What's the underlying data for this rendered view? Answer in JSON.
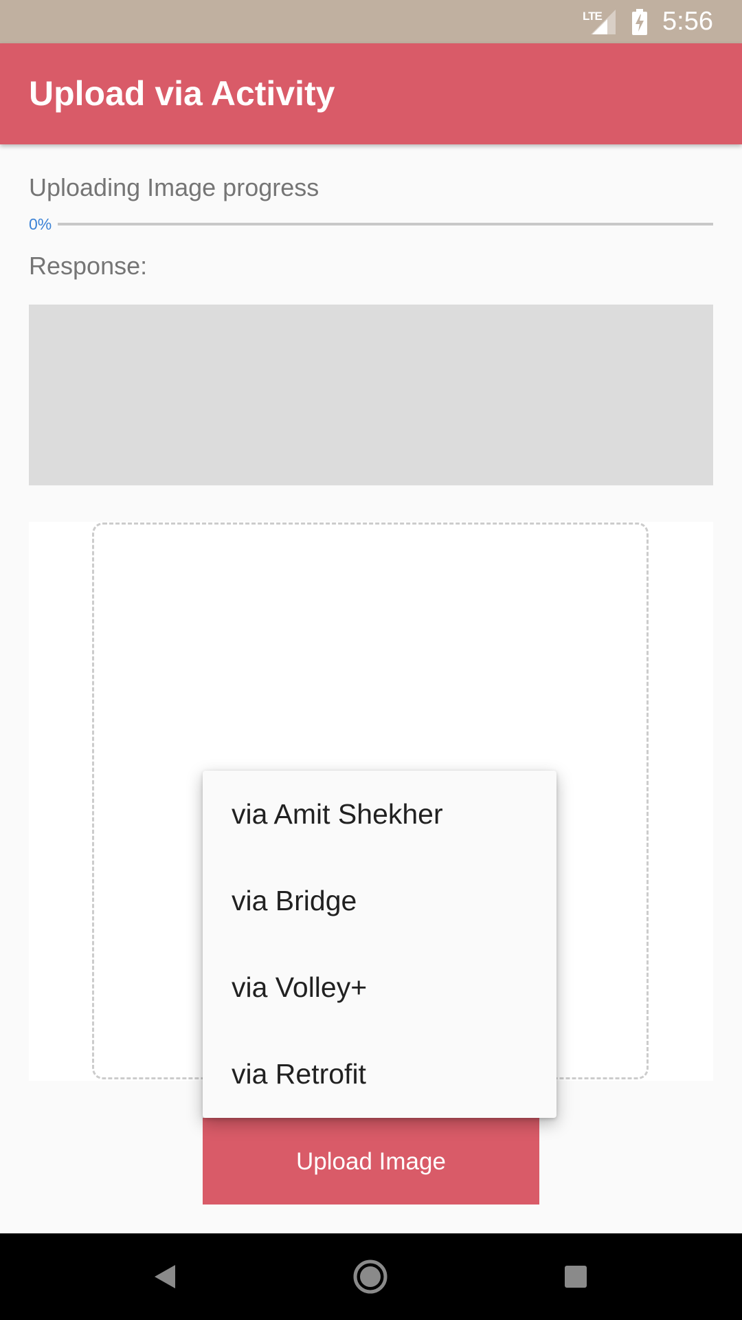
{
  "status_bar": {
    "network_label": "LTE",
    "time": "5:56",
    "icons": [
      "lte-signal-icon",
      "battery-charging-icon"
    ]
  },
  "app_bar": {
    "title": "Upload via Activity",
    "color": "#d95b68"
  },
  "progress": {
    "label": "Uploading Image progress",
    "percent_text": "0%",
    "value": 0
  },
  "response": {
    "label": "Response:",
    "text": ""
  },
  "popup_menu": {
    "items": [
      "via Amit Shekher",
      "via Bridge",
      "via Volley+",
      "via Retrofit"
    ]
  },
  "upload_button": {
    "label": "Upload Image"
  },
  "nav_bar": {
    "icons": [
      "back-icon",
      "home-icon",
      "recents-icon"
    ]
  }
}
